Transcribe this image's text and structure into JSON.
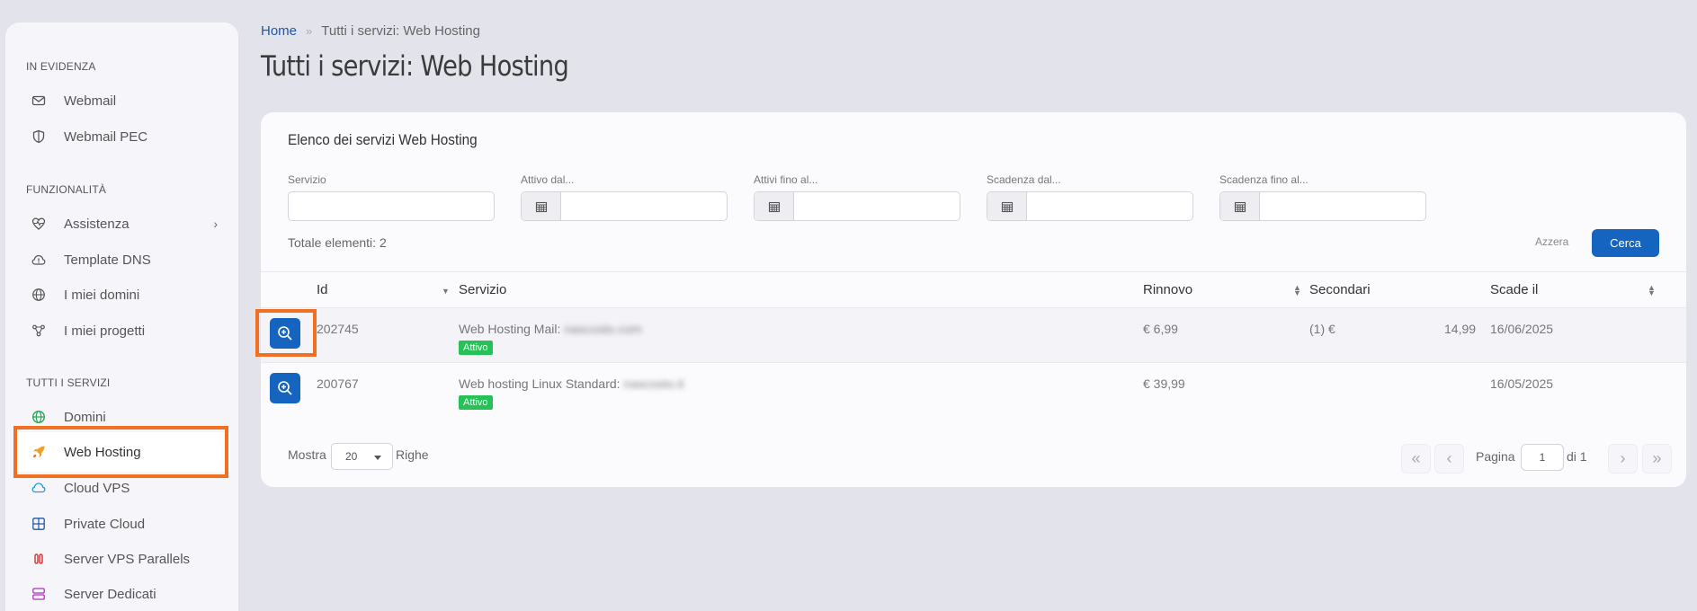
{
  "sidebar": {
    "sections": [
      {
        "title": "IN EVIDENZA",
        "items": [
          {
            "label": "Webmail",
            "icon": "envelope-icon"
          },
          {
            "label": "Webmail PEC",
            "icon": "shield-icon"
          }
        ]
      },
      {
        "title": "FUNZIONALITÀ",
        "items": [
          {
            "label": "Assistenza",
            "icon": "heart-pulse-icon",
            "has_submenu": true
          },
          {
            "label": "Template DNS",
            "icon": "warning-cloud-icon"
          },
          {
            "label": "I miei domini",
            "icon": "globe-icon"
          },
          {
            "label": "I miei progetti",
            "icon": "share-nodes-icon"
          }
        ]
      },
      {
        "title": "TUTTI I SERVIZI",
        "items": [
          {
            "label": "Domini",
            "icon": "globe-green-icon"
          },
          {
            "label": "Web Hosting",
            "icon": "rocket-icon",
            "active": true
          },
          {
            "label": "Cloud VPS",
            "icon": "cloud-icon"
          },
          {
            "label": "Private Cloud",
            "icon": "grid-icon"
          },
          {
            "label": "Server VPS Parallels",
            "icon": "parallels-icon"
          },
          {
            "label": "Server Dedicati",
            "icon": "server-icon"
          }
        ]
      }
    ],
    "chevron": "›"
  },
  "breadcrumb": {
    "home": "Home",
    "separator": "»",
    "current": "Tutti i servizi: Web Hosting"
  },
  "page_title": "Tutti i servizi: Web Hosting",
  "card": {
    "title": "Elenco dei servizi Web Hosting",
    "filters": [
      {
        "label": "Servizio",
        "value": "",
        "has_calendar": false
      },
      {
        "label": "Attivo dal...",
        "value": "",
        "has_calendar": true
      },
      {
        "label": "Attivi fino al...",
        "value": "",
        "has_calendar": true
      },
      {
        "label": "Scadenza dal...",
        "value": "",
        "has_calendar": true
      },
      {
        "label": "Scadenza fino al...",
        "value": "",
        "has_calendar": true
      }
    ],
    "total_label": "Totale elementi: 2",
    "reset_label": "Azzera",
    "search_label": "Cerca"
  },
  "table": {
    "columns": [
      "Id",
      "Servizio",
      "Rinnovo",
      "Secondari",
      "Scade il"
    ],
    "rows": [
      {
        "id": "202745",
        "service": "Web Hosting Mail:",
        "domain": "nascosto.com",
        "status": "Attivo",
        "renewal": "€ 6,99",
        "secondary_count": "(1) €",
        "secondary_value": "14,99",
        "expires": "16/06/2025"
      },
      {
        "id": "200767",
        "service": "Web hosting Linux Standard:",
        "domain": "nascosto.it",
        "status": "Attivo",
        "renewal": "€ 39,99",
        "secondary_count": "",
        "secondary_value": "",
        "expires": "16/05/2025"
      }
    ]
  },
  "footer": {
    "show_label": "Mostra",
    "rows_value": "20",
    "rows_label": "Righe",
    "page_label": "Pagina",
    "page_value": "1",
    "of_label": "di 1",
    "first": "«",
    "prev": "‹",
    "next": "›",
    "last": "»"
  },
  "colors": {
    "accent": "#1565c0",
    "badge": "#26c258",
    "highlight": "#f07023"
  }
}
